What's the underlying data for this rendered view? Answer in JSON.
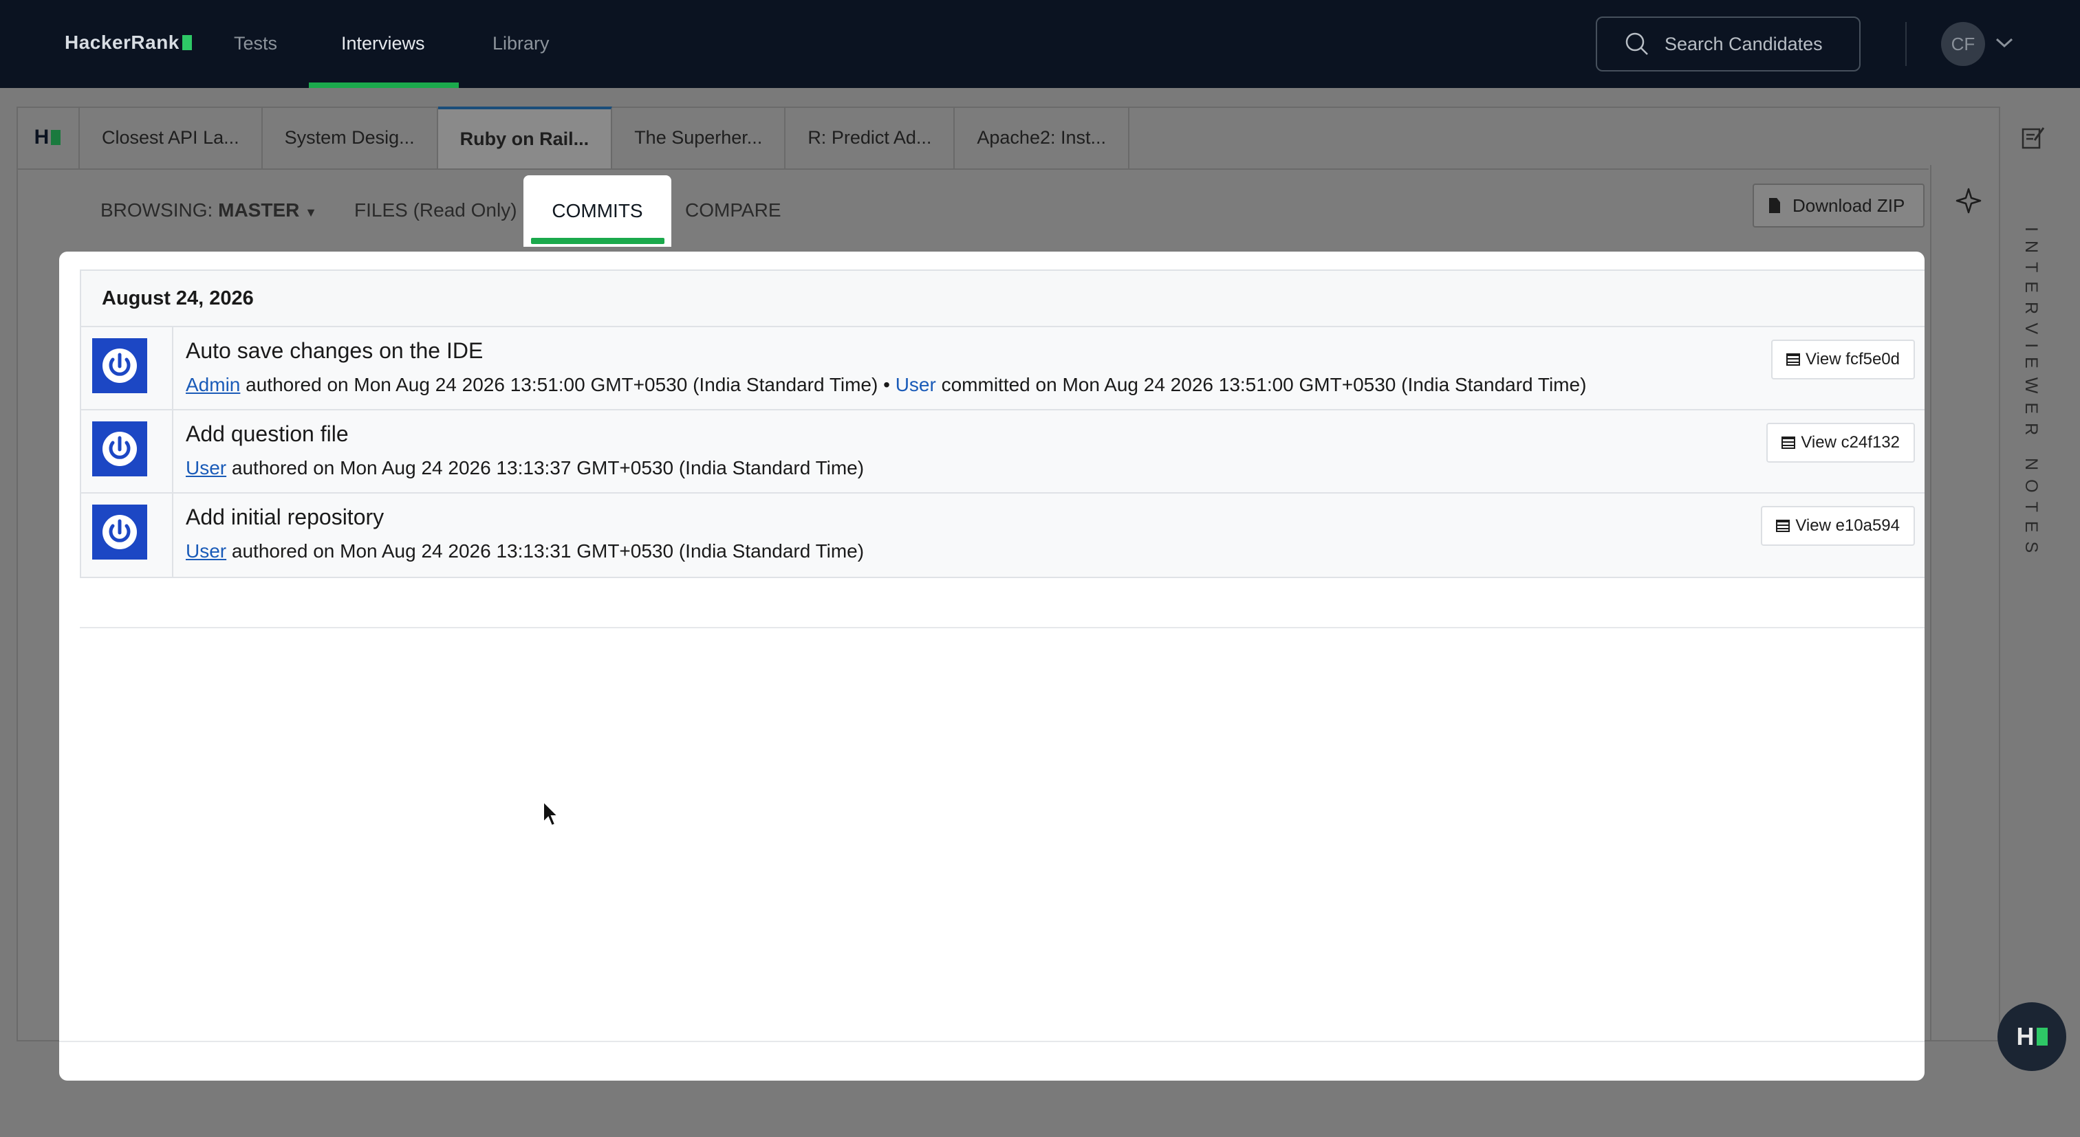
{
  "topnav": {
    "brand": "HackerRank",
    "items": [
      {
        "label": "Tests"
      },
      {
        "label": "Interviews"
      },
      {
        "label": "Library"
      }
    ],
    "active_item": "Interviews",
    "search_placeholder": "Search Candidates",
    "avatar_initials": "CF",
    "accent_color": "#1ba94c"
  },
  "workspace": {
    "tabs": [
      {
        "label": "Closest API La..."
      },
      {
        "label": "System Desig..."
      },
      {
        "label": "Ruby on Rail..."
      },
      {
        "label": "The Superher..."
      },
      {
        "label": "R: Predict Ad..."
      },
      {
        "label": "Apache2: Inst..."
      }
    ],
    "active_tab": "Ruby on Rail...",
    "subnav": {
      "browsing_label": "BROWSING:",
      "branch": "MASTER",
      "files_label": "FILES (Read Only)",
      "commits_label": "COMMITS",
      "compare_label": "COMPARE",
      "download_label": "Download ZIP"
    },
    "notes_label": "INTERVIEWER NOTES"
  },
  "commits": {
    "date": "August 24, 2026",
    "rows": [
      {
        "message": "Auto save changes on the IDE",
        "author": "Admin",
        "authored_text": "authored on Mon Aug 24 2026 13:51:00 GMT+0530 (India Standard Time) •",
        "committer": "User",
        "committed_text": "committed on Mon Aug 24 2026 13:51:00 GMT+0530 (India Standard Time)",
        "view_label": "View fcf5e0d"
      },
      {
        "message": "Add question file",
        "author": "User",
        "authored_text": "authored on Mon Aug 24 2026 13:13:37 GMT+0530 (India Standard Time)",
        "view_label": "View c24f132"
      },
      {
        "message": "Add initial repository",
        "author": "User",
        "authored_text": "authored on Mon Aug 24 2026 13:13:31 GMT+0530 (India Standard Time)",
        "view_label": "View e10a594"
      }
    ]
  },
  "icons": [
    "search-icon",
    "chevron-down-icon",
    "edit-notes-icon",
    "ai-sparkle-icon",
    "file-icon",
    "list-icon",
    "power-icon",
    "mouse-cursor-icon"
  ]
}
